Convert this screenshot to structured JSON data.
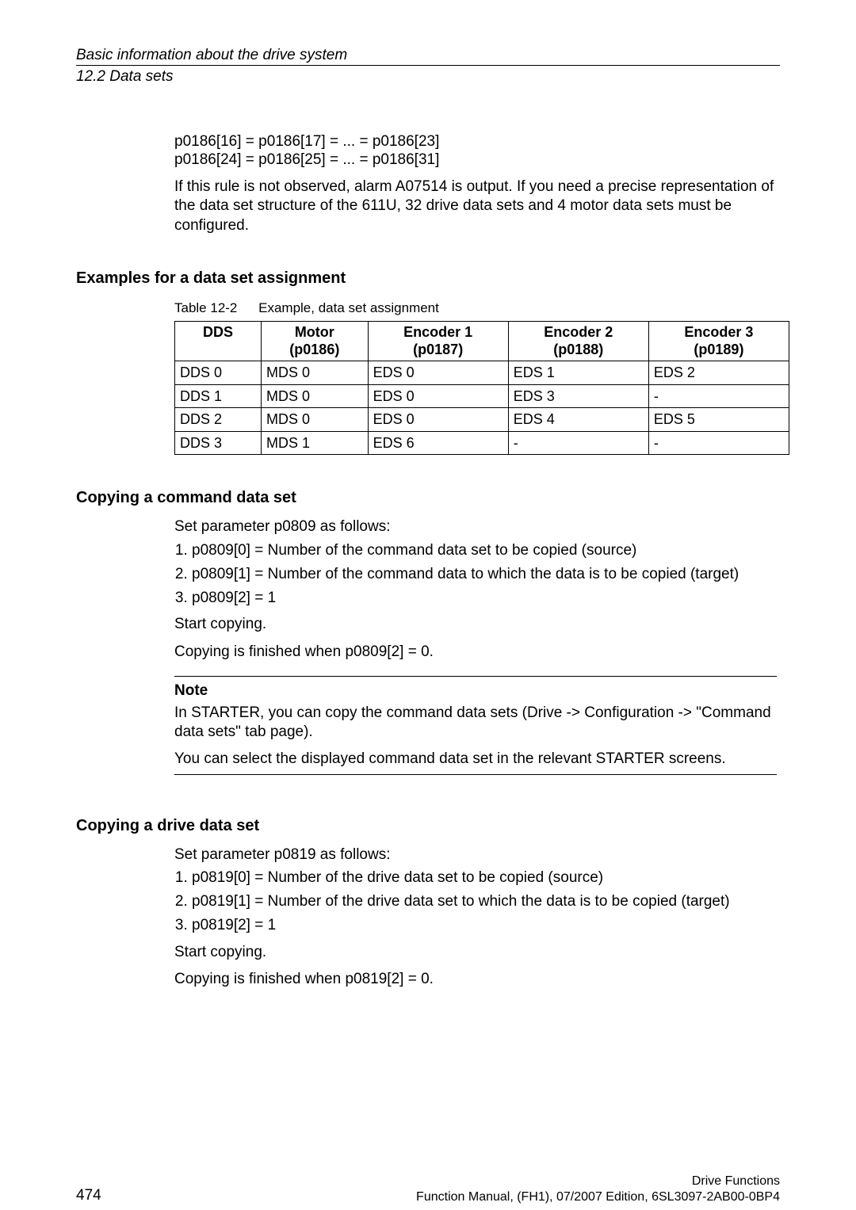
{
  "header": {
    "title_italic": "Basic information about the drive system",
    "section": "12.2 Data sets"
  },
  "top_code": {
    "line1": "p0186[16] = p0186[17] = ... = p0186[23]",
    "line2": "p0186[24] = p0186[25] = ... = p0186[31]"
  },
  "top_para": "If this rule is not observed, alarm A07514 is output. If you need a precise representation of the data set structure of the 611U, 32 drive data sets and 4 motor data sets must be configured.",
  "examples": {
    "heading": "Examples for a data set assignment",
    "table_caption_num": "Table 12-2",
    "table_caption_text": "Example, data set assignment",
    "headers": {
      "dds": "DDS",
      "motor_line1": "Motor",
      "motor_line2": "(p0186)",
      "enc1_line1": "Encoder 1",
      "enc1_line2": "(p0187)",
      "enc2_line1": "Encoder 2",
      "enc2_line2": "(p0188)",
      "enc3_line1": "Encoder 3",
      "enc3_line2": "(p0189)"
    },
    "rows": [
      {
        "dds": "DDS 0",
        "motor": "MDS 0",
        "e1": "EDS 0",
        "e2": "EDS 1",
        "e3": "EDS 2"
      },
      {
        "dds": "DDS 1",
        "motor": "MDS 0",
        "e1": "EDS 0",
        "e2": "EDS 3",
        "e3": "-"
      },
      {
        "dds": "DDS 2",
        "motor": "MDS 0",
        "e1": "EDS 0",
        "e2": "EDS 4",
        "e3": "EDS 5"
      },
      {
        "dds": "DDS 3",
        "motor": "MDS 1",
        "e1": "EDS 6",
        "e2": "-",
        "e3": "-"
      }
    ]
  },
  "copy_cmd": {
    "heading": "Copying a command data set",
    "intro": "Set parameter p0809 as follows:",
    "steps": [
      "p0809[0] = Number of the command data set to be copied (source)",
      "p0809[1] = Number of the command data to which the data is to be copied (target)",
      "p0809[2] = 1"
    ],
    "start": "Start copying.",
    "finished": "Copying is finished when p0809[2] = 0.",
    "note_label": "Note",
    "note_p1": "In STARTER, you can copy the command data sets (Drive -> Configuration -> \"Command data sets\" tab page).",
    "note_p2": "You can select the displayed command data set in the relevant STARTER screens."
  },
  "copy_drive": {
    "heading": "Copying a drive data set",
    "intro": "Set parameter p0819 as follows:",
    "steps": [
      "p0819[0] = Number of the drive data set to be copied (source)",
      "p0819[1] = Number of the drive data set to which the data is to be copied (target)",
      "p0819[2] = 1"
    ],
    "start": "Start copying.",
    "finished": "Copying is finished when p0819[2] = 0."
  },
  "footer": {
    "page": "474",
    "right1": "Drive Functions",
    "right2": "Function Manual, (FH1), 07/2007 Edition, 6SL3097-2AB00-0BP4"
  }
}
